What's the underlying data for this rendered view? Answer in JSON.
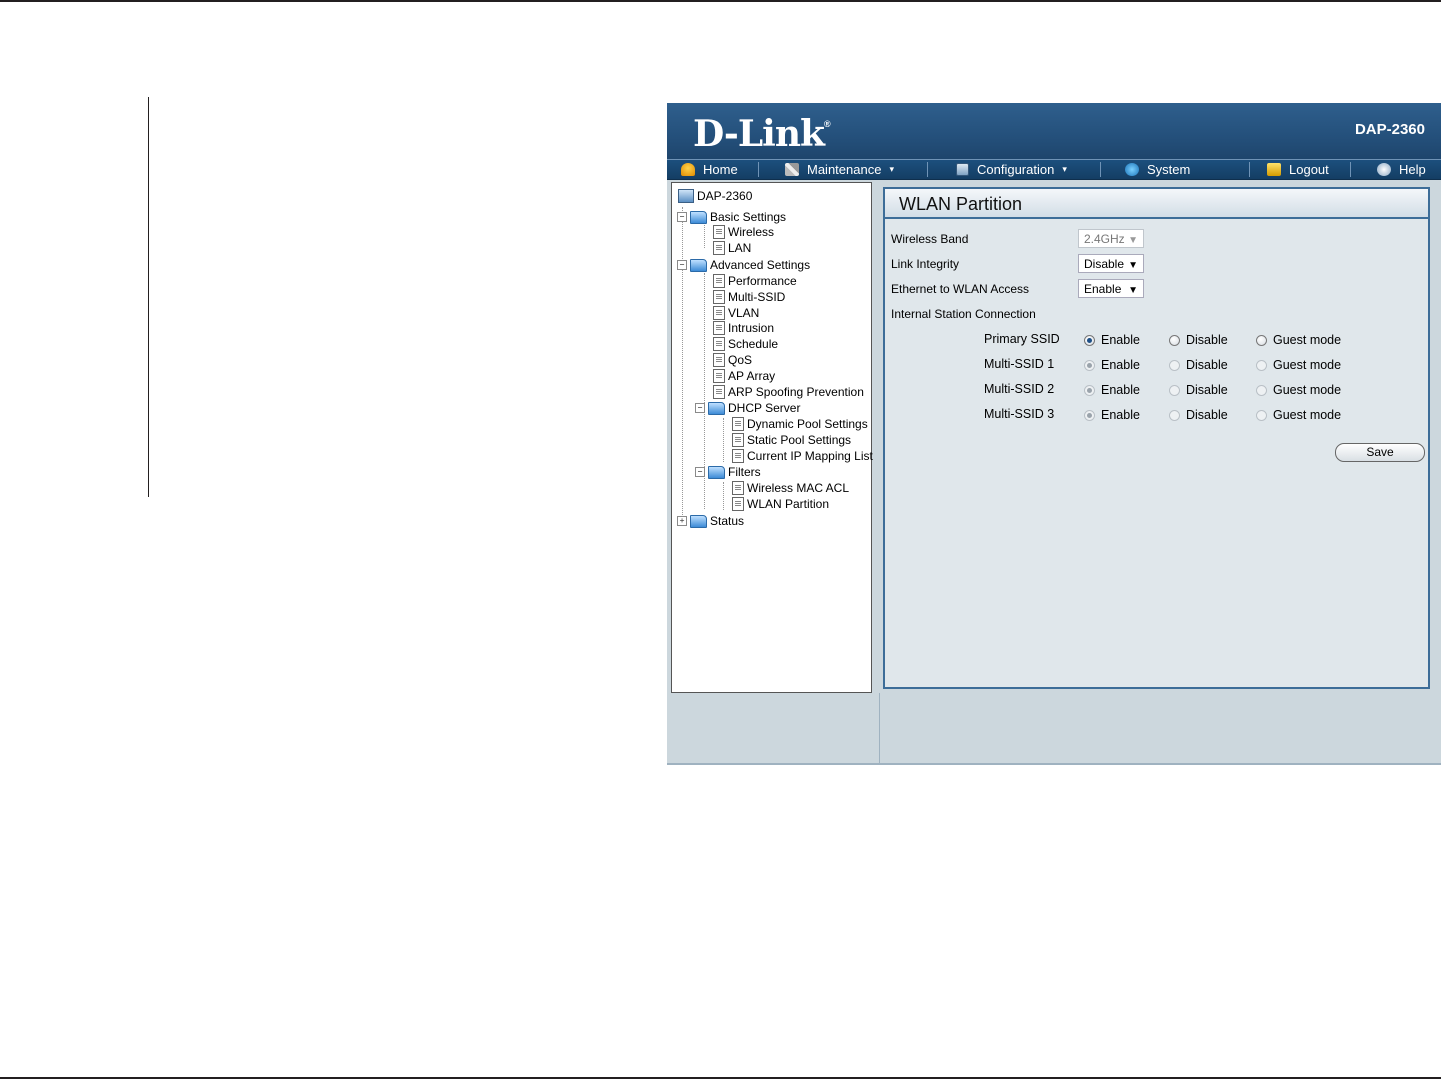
{
  "brand": {
    "logo_text": "D-Link",
    "logo_mark": "®",
    "model": "DAP-2360"
  },
  "menu": {
    "home": "Home",
    "maintenance": "Maintenance",
    "configuration": "Configuration",
    "system": "System",
    "logout": "Logout",
    "help": "Help",
    "dropdown_caret": "▾"
  },
  "tree": {
    "root": "DAP-2360",
    "basic_settings": "Basic Settings",
    "wireless": "Wireless",
    "lan": "LAN",
    "advanced_settings": "Advanced Settings",
    "performance": "Performance",
    "multi_ssid": "Multi-SSID",
    "vlan": "VLAN",
    "intrusion": "Intrusion",
    "schedule": "Schedule",
    "qos": "QoS",
    "ap_array": "AP Array",
    "arp_spoofing": "ARP Spoofing Prevention",
    "dhcp_server": "DHCP Server",
    "dynamic_pool": "Dynamic Pool Settings",
    "static_pool": "Static Pool Settings",
    "ip_mapping": "Current IP Mapping List",
    "filters": "Filters",
    "wireless_mac_acl": "Wireless MAC ACL",
    "wlan_partition": "WLAN Partition",
    "status": "Status",
    "expanded_sign": "−",
    "collapsed_sign": "+"
  },
  "panel": {
    "title": "WLAN Partition",
    "wireless_band_label": "Wireless Band",
    "wireless_band_value": "2.4GHz",
    "link_integrity_label": "Link Integrity",
    "link_integrity_value": "Disable",
    "eth_to_wlan_label": "Ethernet to WLAN Access",
    "eth_to_wlan_value": "Enable",
    "internal_station_label": "Internal Station Connection",
    "option_enable": "Enable",
    "option_disable": "Disable",
    "option_guest": "Guest mode",
    "ssid_rows": [
      {
        "label": "Primary SSID",
        "selected": "Enable",
        "disabled": false
      },
      {
        "label": "Multi-SSID 1",
        "selected": "Enable",
        "disabled": true
      },
      {
        "label": "Multi-SSID 2",
        "selected": "Enable",
        "disabled": true
      },
      {
        "label": "Multi-SSID 3",
        "selected": "Enable",
        "disabled": true
      }
    ],
    "save_label": "Save",
    "select_arrow": "▼"
  }
}
